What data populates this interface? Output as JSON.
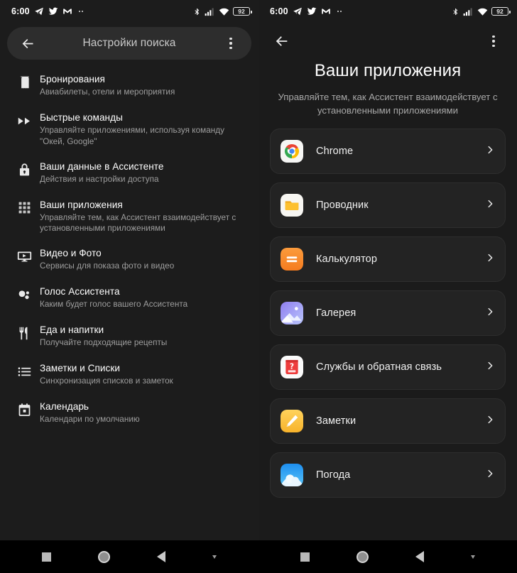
{
  "statusbar": {
    "time": "6:00",
    "left_icons": [
      "telegram-icon",
      "twitter-icon",
      "gmail-icon",
      "more-notifications-icon"
    ],
    "right_icons": [
      "bluetooth-icon",
      "cellular-signal-icon",
      "wifi-icon",
      "battery-icon"
    ],
    "battery_level": "92"
  },
  "left_screen": {
    "appbar": {
      "back_label": "back-arrow",
      "title": "Настройки поиска",
      "overflow_label": "more-options"
    },
    "items": [
      {
        "icon": "receipt-icon",
        "title": "Бронирования",
        "subtitle": "Авиабилеты, отели и мероприятия"
      },
      {
        "icon": "fast-forward-icon",
        "title": "Быстрые команды",
        "subtitle": "Управляйте приложениями, используя команду \"Окей, Google\""
      },
      {
        "icon": "lock-icon",
        "title": "Ваши данные в Ассистенте",
        "subtitle": "Действия и настройки доступа"
      },
      {
        "icon": "apps-grid-icon",
        "title": "Ваши приложения",
        "subtitle": "Управляйте тем, как Ассистент взаимодействует с установленными приложениями"
      },
      {
        "icon": "video-player-icon",
        "title": "Видео и Фото",
        "subtitle": "Сервисы для показа фото и видео"
      },
      {
        "icon": "assistant-voice-icon",
        "title": "Голос Ассистента",
        "subtitle": "Каким будет голос вашего Ассистента"
      },
      {
        "icon": "food-drink-icon",
        "title": "Еда и напитки",
        "subtitle": "Получайте подходящие рецепты"
      },
      {
        "icon": "list-icon",
        "title": "Заметки и Списки",
        "subtitle": "Синхронизация списков и заметок"
      },
      {
        "icon": "calendar-icon",
        "title": "Календарь",
        "subtitle": "Календари по умолчанию"
      }
    ]
  },
  "right_screen": {
    "back_label": "back-arrow",
    "overflow_label": "more-options",
    "title": "Ваши приложения",
    "subtitle": "Управляйте тем, как Ассистент взаимодействует с установленными приложениями",
    "apps": [
      {
        "name": "Chrome",
        "icon": "chrome-app-icon"
      },
      {
        "name": "Проводник",
        "icon": "file-manager-app-icon"
      },
      {
        "name": "Калькулятор",
        "icon": "calculator-app-icon"
      },
      {
        "name": "Галерея",
        "icon": "gallery-app-icon"
      },
      {
        "name": "Службы и обратная связь",
        "icon": "services-feedback-app-icon"
      },
      {
        "name": "Заметки",
        "icon": "notes-app-icon"
      },
      {
        "name": "Погода",
        "icon": "weather-app-icon"
      }
    ]
  },
  "navbar": {
    "recent_label": "recent-apps",
    "home_label": "home",
    "back_label": "back",
    "extra_label": "hide-keyboard"
  },
  "colors": {
    "background": "#1b1b1b",
    "card": "#232323",
    "appbar": "#2d2d2d",
    "primary_text": "#ffffff",
    "secondary_text": "#9e9e9e"
  }
}
